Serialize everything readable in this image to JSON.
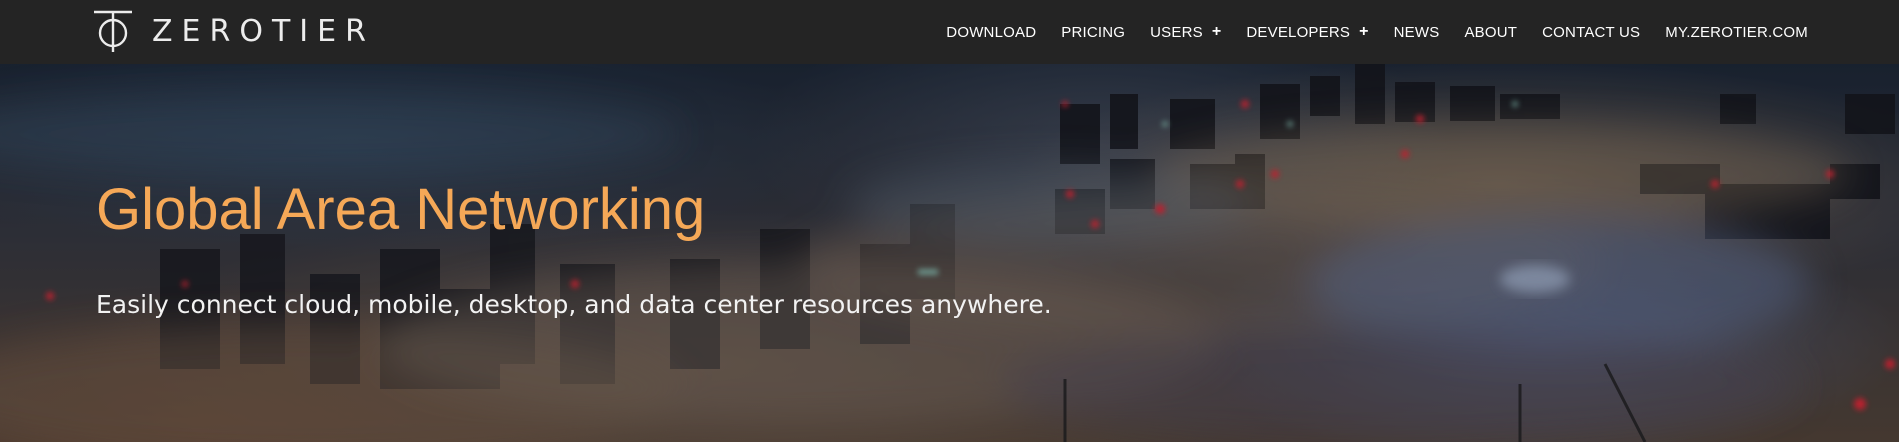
{
  "brand": {
    "name": "ZEROTIER",
    "logo_icon": "zerotier-logo-icon"
  },
  "nav": {
    "items": [
      {
        "label": "DOWNLOAD",
        "has_submenu": false
      },
      {
        "label": "PRICING",
        "has_submenu": false
      },
      {
        "label": "USERS",
        "has_submenu": true,
        "submenu_icon": "plus-icon",
        "submenu_glyph": "+"
      },
      {
        "label": "DEVELOPERS",
        "has_submenu": true,
        "submenu_icon": "plus-icon",
        "submenu_glyph": "+"
      },
      {
        "label": "NEWS",
        "has_submenu": false
      },
      {
        "label": "ABOUT",
        "has_submenu": false
      },
      {
        "label": "CONTACT US",
        "has_submenu": false
      },
      {
        "label": "MY.ZEROTIER.COM",
        "has_submenu": false
      }
    ]
  },
  "hero": {
    "title": "Global Area Networking",
    "subtitle": "Easily connect cloud, mobile, desktop, and data center resources anywhere.",
    "background_image": "night city skyline above fog"
  },
  "colors": {
    "navbar_bg": "#242424",
    "accent_orange": "#f5a857",
    "nav_text": "#ffffff",
    "subtitle_text": "#f2f2f2"
  }
}
